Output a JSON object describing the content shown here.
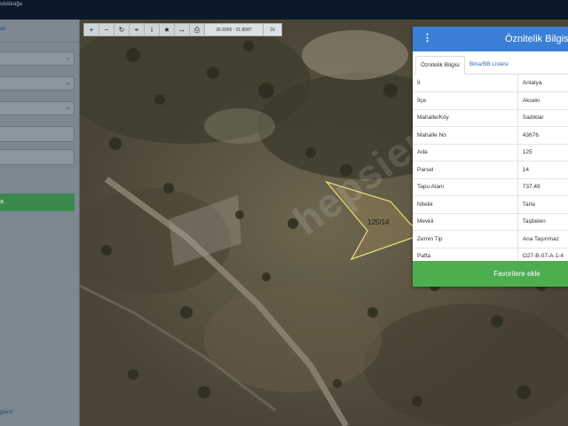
{
  "topbar": {
    "brand": "södürağa"
  },
  "left_panel": {
    "header_text": "ali",
    "filter_button": "a",
    "footer": "gov.tr"
  },
  "toolbar": {
    "tools": [
      {
        "icon": "zoom-in-icon",
        "glyph": "+"
      },
      {
        "icon": "zoom-out-icon",
        "glyph": "−"
      },
      {
        "icon": "refresh-icon",
        "glyph": "↻"
      },
      {
        "icon": "locate-icon",
        "glyph": "⌖"
      },
      {
        "icon": "info-icon",
        "glyph": "i"
      },
      {
        "icon": "star-icon",
        "glyph": "★"
      },
      {
        "icon": "measure-icon",
        "glyph": "↔"
      },
      {
        "icon": "print-icon",
        "glyph": "⎙"
      }
    ],
    "coords": "36.9366 : 31.8087",
    "zoom": "16"
  },
  "map": {
    "parcel_label": "125/14",
    "watermark": "hepsiemlak"
  },
  "attribute_panel": {
    "title": "Öznitelik Bilgisi",
    "tabs": [
      "Öznitelik Bilgisi",
      "Bina/BB Listesi"
    ],
    "rows": [
      {
        "key": "İl",
        "value": "Antalya"
      },
      {
        "key": "İlçe",
        "value": "Akseki"
      },
      {
        "key": "Mahalle/Köy",
        "value": "Sadıklar"
      },
      {
        "key": "Mahalle No",
        "value": "43676"
      },
      {
        "key": "Ada",
        "value": "125"
      },
      {
        "key": "Parsel",
        "value": "14"
      },
      {
        "key": "Tapu Alanı",
        "value": "737,49"
      },
      {
        "key": "Nitelik",
        "value": "Tarla"
      },
      {
        "key": "Mevkii",
        "value": "Taşbelen"
      },
      {
        "key": "Zemin Tip",
        "value": "Ana Taşınmaz"
      },
      {
        "key": "Pafta",
        "value": "O27-B-07-A-1-4"
      }
    ],
    "favorite_button": "Favorilere ekle"
  },
  "colors": {
    "header_blue": "#3a7fd5",
    "favorite_green": "#4cae4f",
    "parcel_outline": "#e6e07a"
  }
}
